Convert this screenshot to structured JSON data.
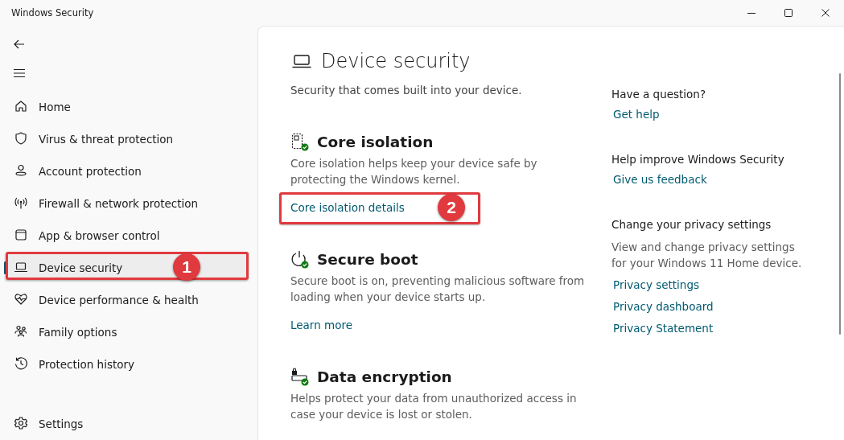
{
  "window": {
    "title": "Windows Security"
  },
  "sidebar": {
    "items": [
      {
        "label": "Home",
        "selected": false
      },
      {
        "label": "Virus & threat protection",
        "selected": false
      },
      {
        "label": "Account protection",
        "selected": false
      },
      {
        "label": "Firewall & network protection",
        "selected": false
      },
      {
        "label": "App & browser control",
        "selected": false
      },
      {
        "label": "Device security",
        "selected": true,
        "callout": "1"
      },
      {
        "label": "Device performance & health",
        "selected": false
      },
      {
        "label": "Family options",
        "selected": false
      },
      {
        "label": "Protection history",
        "selected": false
      }
    ],
    "settings": "Settings"
  },
  "page": {
    "title": "Device security",
    "subtitle": "Security that comes built into your device.",
    "sections": [
      {
        "title": "Core isolation",
        "description": "Core isolation helps keep your device safe by protecting the Windows kernel.",
        "link": "Core isolation details",
        "callout": "2"
      },
      {
        "title": "Secure boot",
        "description": "Secure boot is on, preventing malicious software from loading when your device starts up.",
        "link": "Learn more"
      },
      {
        "title": "Data encryption",
        "description": "Helps protect your data from unauthorized access in case your device is lost or stolen."
      }
    ]
  },
  "aside": [
    {
      "heading": "Have a question?",
      "links": [
        "Get help"
      ]
    },
    {
      "heading": "Help improve Windows Security",
      "links": [
        "Give us feedback"
      ]
    },
    {
      "heading": "Change your privacy settings",
      "description": "View and change privacy settings for your Windows 11 Home device.",
      "links": [
        "Privacy settings",
        "Privacy dashboard",
        "Privacy Statement"
      ]
    }
  ]
}
